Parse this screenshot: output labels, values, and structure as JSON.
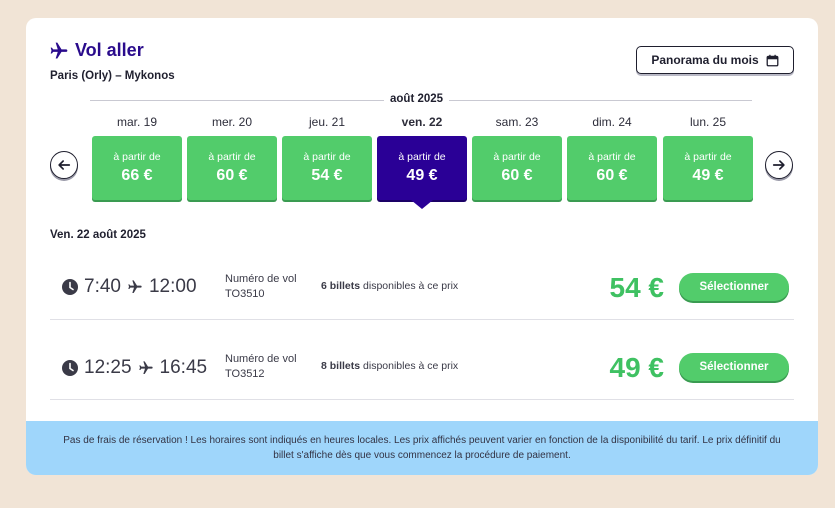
{
  "header": {
    "title": "Vol aller",
    "route": "Paris (Orly) – Mykonos",
    "panorama_label": "Panorama du mois"
  },
  "calendar": {
    "month": "août 2025",
    "days": [
      {
        "label": "mar. 19",
        "from": "à partir de",
        "price": "66 €",
        "selected": false
      },
      {
        "label": "mer. 20",
        "from": "à partir de",
        "price": "60 €",
        "selected": false
      },
      {
        "label": "jeu. 21",
        "from": "à partir de",
        "price": "54 €",
        "selected": false
      },
      {
        "label": "ven. 22",
        "from": "à partir de",
        "price": "49 €",
        "selected": true
      },
      {
        "label": "sam. 23",
        "from": "à partir de",
        "price": "60 €",
        "selected": false
      },
      {
        "label": "dim. 24",
        "from": "à partir de",
        "price": "60 €",
        "selected": false
      },
      {
        "label": "lun. 25",
        "from": "à partir de",
        "price": "49 €",
        "selected": false
      }
    ]
  },
  "selected_date": "Ven. 22 août 2025",
  "flights": [
    {
      "depart": "7:40",
      "arrive": "12:00",
      "number_label": "Numéro de vol",
      "number": "TO3510",
      "seats": "6 billets",
      "seats_suffix": "disponibles à ce prix",
      "price": "54 €",
      "select_label": "Sélectionner"
    },
    {
      "depart": "12:25",
      "arrive": "16:45",
      "number_label": "Numéro de vol",
      "number": "TO3512",
      "seats": "8 billets",
      "seats_suffix": "disponibles à ce prix",
      "price": "49 €",
      "select_label": "Sélectionner"
    }
  ],
  "footer": {
    "text": "Pas de frais de réservation ! Les horaires sont indiqués en heures locales. Les prix affichés peuvent varier en fonction de la disponibilité du tarif. Le prix définitif du billet s'affiche dès que vous commencez la procédure de paiement."
  },
  "colors": {
    "brand": "#2a0b8c",
    "price_green": "#52cc6b",
    "selected_day": "#2a0096",
    "footer_bg": "#9fd6fb"
  },
  "icons": {
    "title": "plane-icon",
    "panorama": "calendar-icon",
    "prev": "arrow-left-icon",
    "next": "arrow-right-icon",
    "time": "clock-icon",
    "route": "plane-icon"
  }
}
